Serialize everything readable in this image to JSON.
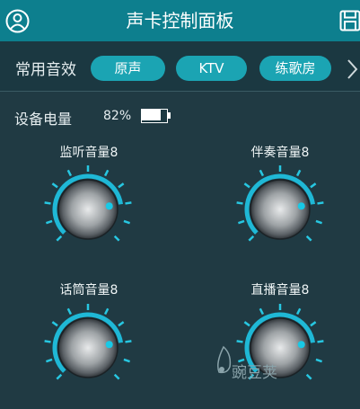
{
  "header": {
    "title": "声卡控制面板",
    "left_icon": "user-icon",
    "right_icon": "save-icon"
  },
  "effects": {
    "label": "常用音效",
    "options": [
      "原声",
      "KTV",
      "练歌房"
    ],
    "more_icon": "chevron-right-icon"
  },
  "battery": {
    "label": "设备电量",
    "percent_text": "82%",
    "level": 0.82
  },
  "knobs": [
    {
      "label": "监听音量8",
      "value": 8
    },
    {
      "label": "伴奏音量8",
      "value": 8
    },
    {
      "label": "话筒音量8",
      "value": 8
    },
    {
      "label": "直播音量8",
      "value": 8
    }
  ],
  "watermark": {
    "text": "豌豆荚",
    "icon": "pea-pod-logo"
  },
  "colors": {
    "header": "#0d7f8e",
    "accent": "#1ba4b3",
    "background": "#203a43",
    "tick": "#27c7e1"
  }
}
